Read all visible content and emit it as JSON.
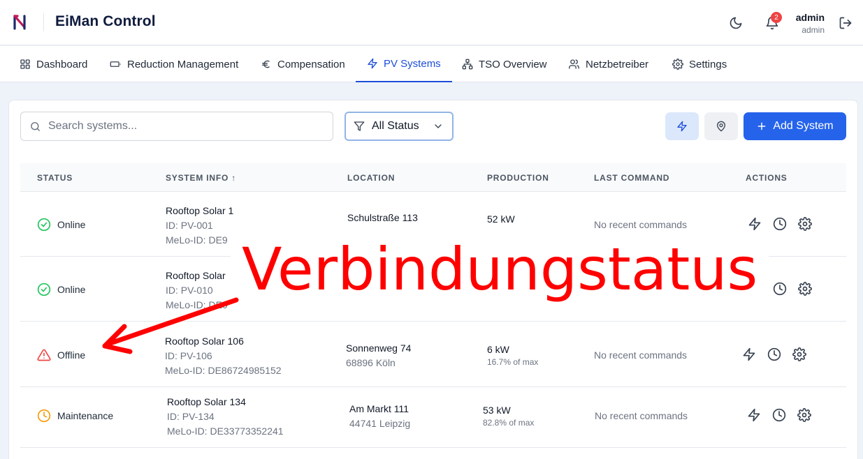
{
  "header": {
    "app_title": "EiMan Control",
    "notification_count": "2",
    "user_name": "admin",
    "user_role": "admin"
  },
  "nav": {
    "items": [
      {
        "label": "Dashboard",
        "icon": "grid-icon"
      },
      {
        "label": "Reduction Management",
        "icon": "battery-icon"
      },
      {
        "label": "Compensation",
        "icon": "euro-icon"
      },
      {
        "label": "PV Systems",
        "icon": "bolt-icon",
        "active": true
      },
      {
        "label": "TSO Overview",
        "icon": "network-icon"
      },
      {
        "label": "Netzbetreiber",
        "icon": "users-icon"
      },
      {
        "label": "Settings",
        "icon": "gear-icon"
      }
    ]
  },
  "toolbar": {
    "search_placeholder": "Search systems...",
    "status_filter": "All Status",
    "add_label": "Add System"
  },
  "table": {
    "headers": {
      "status": "STATUS",
      "system_info": "SYSTEM INFO ↑",
      "location": "LOCATION",
      "production": "PRODUCTION",
      "last_command": "LAST COMMAND",
      "actions": "ACTIONS"
    },
    "rows": [
      {
        "status": "Online",
        "name": "Rooftop Solar 1",
        "id": "ID: PV-001",
        "melo": "MeLo-ID: DE9",
        "street": "Schulstraße 113",
        "city": "",
        "production": "52 kW",
        "pct": "",
        "last_command": "No recent commands"
      },
      {
        "status": "Online",
        "name": "Rooftop Solar",
        "id": "ID: PV-010",
        "melo": "MeLo-ID: DE0",
        "street": "",
        "city": "",
        "production": "",
        "pct": "",
        "last_command": ""
      },
      {
        "status": "Offline",
        "name": "Rooftop Solar 106",
        "id": "ID: PV-106",
        "melo": "MeLo-ID: DE86724985152",
        "street": "Sonnenweg 74",
        "city": "68896 Köln",
        "production": "6 kW",
        "pct": "16.7% of max",
        "last_command": "No recent commands"
      },
      {
        "status": "Maintenance",
        "name": "Rooftop Solar 134",
        "id": "ID: PV-134",
        "melo": "MeLo-ID: DE33773352241",
        "street": "Am Markt 111",
        "city": "44741 Leipzig",
        "production": "53 kW",
        "pct": "82.8% of max",
        "last_command": "No recent commands"
      }
    ]
  },
  "annotation": {
    "text": "Verbindungstatus"
  },
  "colors": {
    "accent": "#2563eb",
    "online": "#22c55e",
    "offline": "#ef4444",
    "maintenance": "#f59e0b",
    "annotation": "#ff0000"
  }
}
